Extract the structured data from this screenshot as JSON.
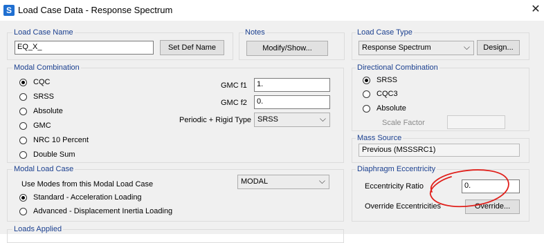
{
  "window": {
    "title": "Load Case Data - Response Spectrum"
  },
  "load_case_name": {
    "group_label": "Load Case Name",
    "value": "EQ_X_",
    "set_def_button": "Set Def Name"
  },
  "notes": {
    "group_label": "Notes",
    "button": "Modify/Show..."
  },
  "load_case_type": {
    "group_label": "Load Case Type",
    "selected": "Response Spectrum",
    "design_button": "Design..."
  },
  "modal_combination": {
    "group_label": "Modal Combination",
    "options": [
      "CQC",
      "SRSS",
      "Absolute",
      "GMC",
      "NRC 10 Percent",
      "Double Sum"
    ],
    "selected": "CQC",
    "gmc_f1": {
      "label": "GMC  f1",
      "value": "1."
    },
    "gmc_f2": {
      "label": "GMC  f2",
      "value": "0."
    },
    "periodic": {
      "label": "Periodic + Rigid Type",
      "selected": "SRSS"
    }
  },
  "directional_combination": {
    "group_label": "Directional Combination",
    "options": [
      "SRSS",
      "CQC3",
      "Absolute"
    ],
    "selected": "SRSS",
    "scale_factor_label": "Scale Factor",
    "scale_factor_value": ""
  },
  "mass_source": {
    "group_label": "Mass Source",
    "value": "Previous  (MSSSRC1)"
  },
  "modal_load_case": {
    "group_label": "Modal Load Case",
    "use_modes_label": "Use Modes from this Modal Load Case",
    "selected": "MODAL",
    "loading_options": [
      "Standard - Acceleration Loading",
      "Advanced - Displacement Inertia Loading"
    ],
    "loading_selected": "Standard - Acceleration Loading"
  },
  "diaphragm_eccentricity": {
    "group_label": "Diaphragm Eccentricity",
    "ratio_label": "Eccentricity Ratio",
    "ratio_value": "0.",
    "override_label": "Override Eccentricities",
    "override_button": "Override..."
  },
  "loads_applied": {
    "group_label": "Loads Applied"
  },
  "colors": {
    "group_label": "#1a3f8f",
    "annotation": "#e0201b"
  },
  "icons": {
    "app": "app-icon",
    "close": "close-icon",
    "dropdown": "chevron-down-icon"
  }
}
